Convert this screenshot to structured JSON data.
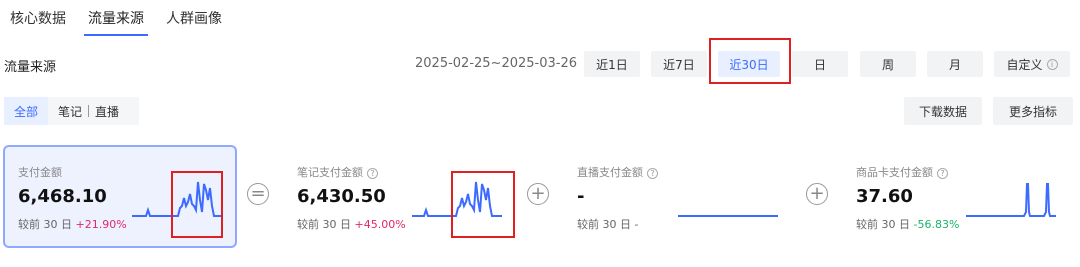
{
  "tabs": [
    {
      "label": "核心数据",
      "active": false
    },
    {
      "label": "流量来源",
      "active": true
    },
    {
      "label": "人群画像",
      "active": false
    }
  ],
  "section_title": "流量来源",
  "date_range": "2025-02-25~2025-03-26",
  "period_buttons": [
    {
      "label": "近1日",
      "active": false
    },
    {
      "label": "近7日",
      "active": false
    },
    {
      "label": "近30日",
      "active": true
    },
    {
      "label": "日",
      "active": false
    },
    {
      "label": "周",
      "active": false
    },
    {
      "label": "月",
      "active": false
    },
    {
      "label": "自定义",
      "active": false
    }
  ],
  "filters": {
    "all": "全部",
    "notes": "笔记",
    "divider": "|",
    "live": "直播"
  },
  "actions": {
    "download": "下载数据",
    "more_metrics": "更多指标"
  },
  "operators": {
    "equals": "=",
    "plus": "+"
  },
  "cards": [
    {
      "label": "支付金额",
      "value": "6,468.10",
      "compare_prefix": "较前 30 日",
      "change": "+21.90%",
      "trend": "up"
    },
    {
      "label": "笔记支付金额",
      "value": "6,430.50",
      "compare_prefix": "较前 30 日",
      "change": "+45.00%",
      "trend": "up"
    },
    {
      "label": "直播支付金额",
      "value": "-",
      "compare_prefix": "较前 30 日",
      "change": "-",
      "trend": "none"
    },
    {
      "label": "商品卡支付金额",
      "value": "37.60",
      "compare_prefix": "较前 30 日",
      "change": "-56.83%",
      "trend": "down"
    }
  ],
  "colors": {
    "accent": "#3d6bff",
    "sparkline": "#3d6bff",
    "highlight_box": "#e02020",
    "up": "#e0286a",
    "down": "#19b36b"
  },
  "icons": {
    "info": "question-circle-icon"
  }
}
